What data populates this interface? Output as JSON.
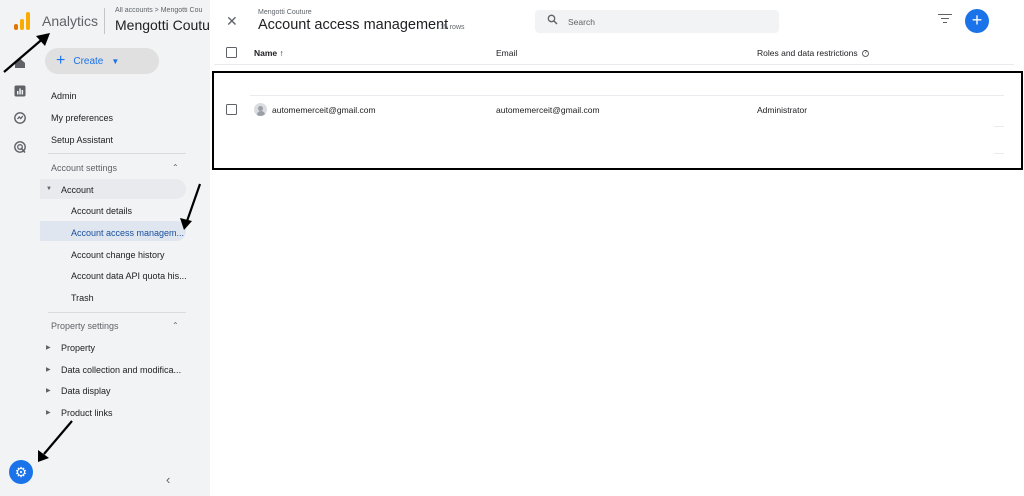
{
  "app": {
    "title": "Analytics",
    "account_breadcrumb": "All accounts > Mengotti Cou",
    "account_name": "Mengotti Coutu"
  },
  "create_button": {
    "label": "Create"
  },
  "nav": {
    "admin": "Admin",
    "my_preferences": "My preferences",
    "setup_assistant": "Setup Assistant",
    "account_settings": "Account settings",
    "account": "Account",
    "account_details": "Account details",
    "account_access": "Account access managem...",
    "account_change_history": "Account change history",
    "account_api_quota": "Account data API quota his...",
    "trash": "Trash",
    "property_settings": "Property settings",
    "property": "Property",
    "data_collection": "Data collection and modifica...",
    "data_display": "Data display",
    "product_links": "Product links"
  },
  "panel": {
    "breadcrumb": "Mengotti Couture",
    "title": "Account access management",
    "row_count": "15 rows",
    "search_placeholder": "Search",
    "columns": {
      "name": "Name ↑",
      "email": "Email",
      "roles": "Roles and data restrictions"
    },
    "rows": [
      {
        "name": "automemerceit@gmail.com",
        "email": "automemerceit@gmail.com",
        "role": "Administrator"
      }
    ]
  },
  "colors": {
    "accent": "#1a73e8",
    "highlight_border": "#000000"
  }
}
